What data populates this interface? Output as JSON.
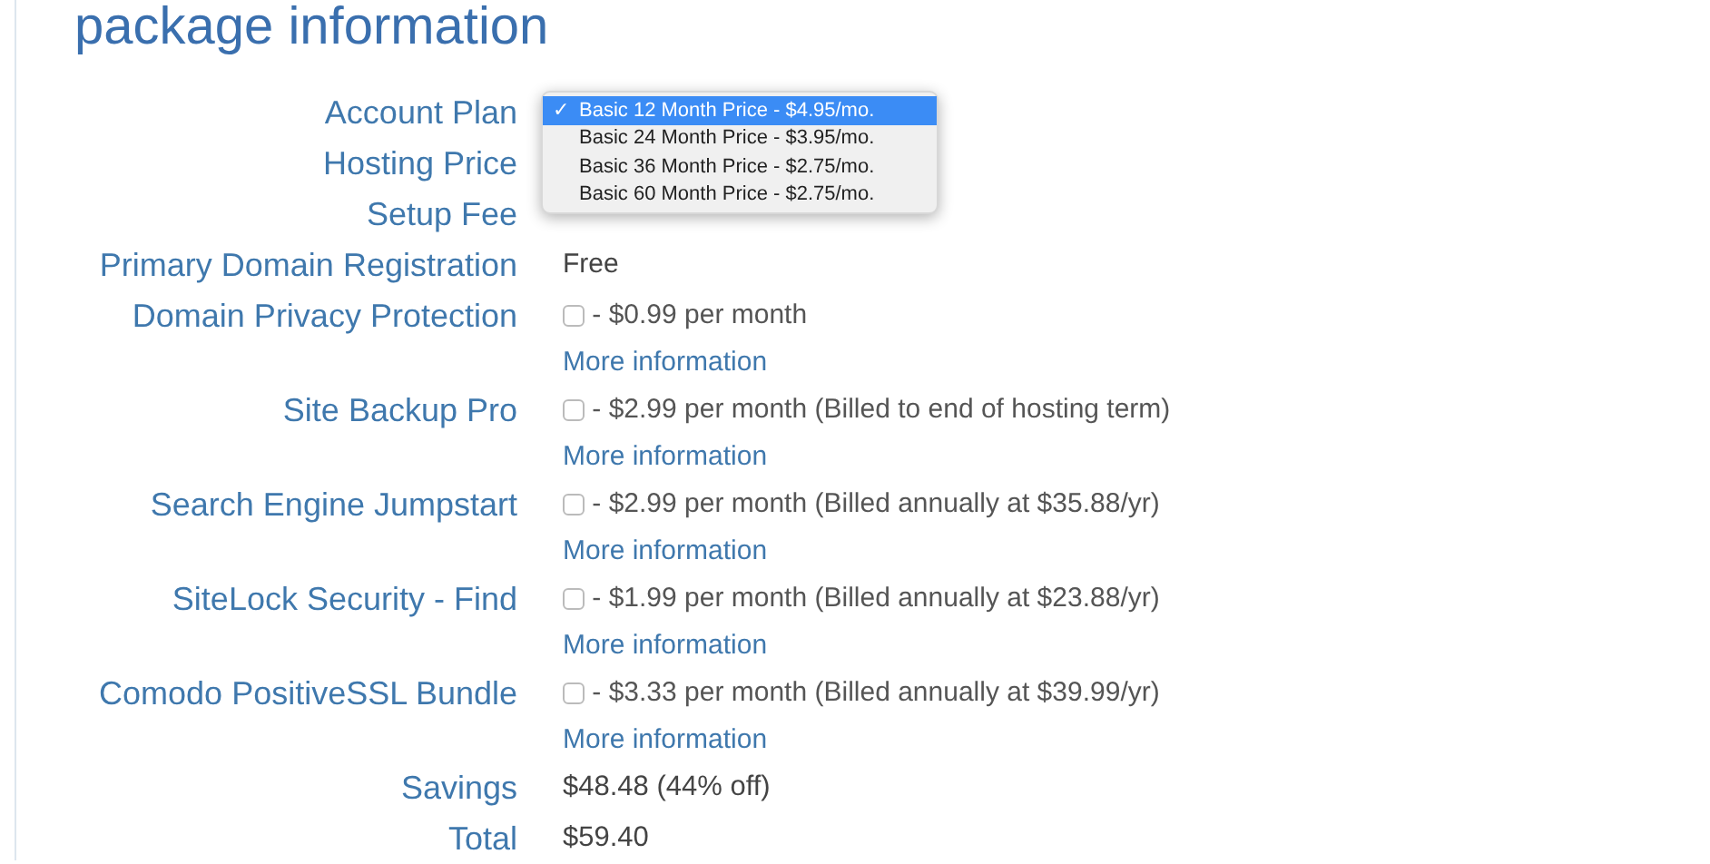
{
  "title": "package information",
  "rows": [
    {
      "kind": "plain",
      "label": "Account Plan"
    },
    {
      "kind": "plain",
      "label": "Hosting Price"
    },
    {
      "kind": "plain",
      "label": "Setup Fee"
    },
    {
      "kind": "plain",
      "label": "Primary Domain Registration",
      "value": "Free"
    },
    {
      "kind": "addon",
      "label": "Domain Privacy Protection",
      "checked": false,
      "value": " - $0.99 per month",
      "link": "More information"
    },
    {
      "kind": "addon",
      "label": "Site Backup Pro",
      "checked": false,
      "value": " - $2.99 per month (Billed to end of hosting term)",
      "link": "More information"
    },
    {
      "kind": "addon",
      "label": "Search Engine Jumpstart",
      "checked": false,
      "value": " - $2.99 per month (Billed annually at $35.88/yr)",
      "link": "More information"
    },
    {
      "kind": "addon",
      "label": "SiteLock Security - Find",
      "checked": false,
      "value": " - $1.99 per month (Billed annually at $23.88/yr)",
      "link": "More information"
    },
    {
      "kind": "addon",
      "label": "Comodo PositiveSSL Bundle",
      "checked": false,
      "value": " - $3.33 per month (Billed annually at $39.99/yr)",
      "link": "More information"
    },
    {
      "kind": "total",
      "label": "Savings",
      "value": "$48.48 (44% off)"
    },
    {
      "kind": "total",
      "label": "Total",
      "value": "$59.40"
    }
  ],
  "plan_menu": {
    "check": "✓",
    "options": [
      {
        "label": "Basic 12 Month Price - $4.95/mo.",
        "selected": true
      },
      {
        "label": "Basic 24 Month Price - $3.95/mo.",
        "selected": false
      },
      {
        "label": "Basic 36 Month Price - $2.75/mo.",
        "selected": false
      },
      {
        "label": "Basic 60 Month Price - $2.75/mo.",
        "selected": false
      }
    ]
  }
}
